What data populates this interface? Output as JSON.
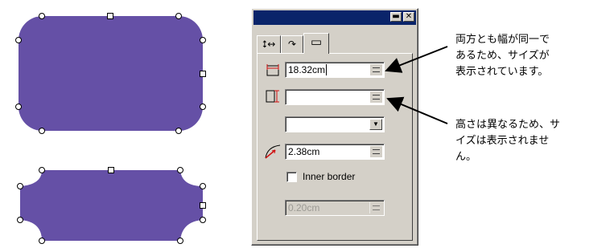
{
  "window": {
    "tabs": [
      {
        "icon": "resize-icon",
        "glyph": "⭥↔"
      },
      {
        "icon": "rotate-icon",
        "glyph": "↷"
      },
      {
        "icon": "rectangle-icon",
        "glyph": "▭"
      }
    ],
    "title_buttons": {
      "minimize": "▬",
      "close": "✕"
    }
  },
  "fields": {
    "width": {
      "value": "18.32cm",
      "icon": "width-icon"
    },
    "height": {
      "value": "",
      "icon": "height-icon"
    },
    "corner_type": {
      "value": ""
    },
    "corner_radius": {
      "value": "2.38cm",
      "icon": "corner-radius-icon"
    },
    "inner_border": {
      "label": "Inner border",
      "checked": false
    },
    "border_width": {
      "value": "0.20cm"
    }
  },
  "callouts": {
    "top": [
      "両方とも幅が同一で",
      "あるため、サイズが",
      "表示されています。"
    ],
    "bottom": [
      "高さは異なるため、サ",
      "イズは表示されませ",
      "ん。"
    ]
  },
  "colors": {
    "shape_fill": "#6550a6",
    "window_face": "#d4d0c8",
    "titlebar": "#0a246a"
  }
}
